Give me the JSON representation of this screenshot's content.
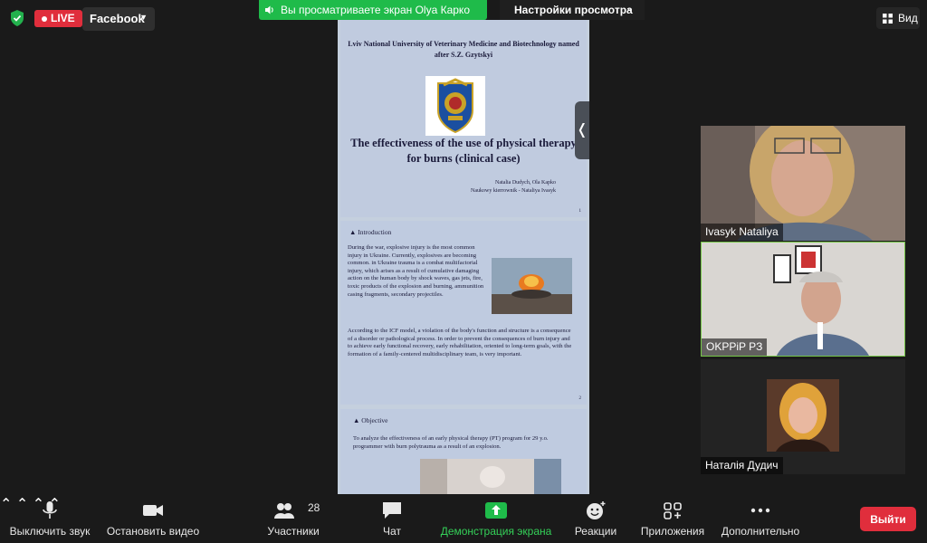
{
  "topbar": {
    "live_label": "LIVE",
    "stream_platform": "Facebook",
    "share_banner": "Вы просматриваете экран Olya Карко",
    "view_options": "Настройки просмотра",
    "view_button": "Вид"
  },
  "slides": {
    "s1": {
      "university": "Lviv National University of Veterinary Medicine and Biotechnology named after  S.Z.  Gzytskyi",
      "title": "The effectiveness of the use of physical therapy for burns (clinical case)",
      "authors_line1": "Natalia Dudych, Ola Kapko",
      "authors_line2": "Naukowy kierrownik - Nataliya Ivasyk",
      "page": "1"
    },
    "s2": {
      "heading": "▲ Introduction",
      "intro": " During the war, explosive injury is the most common injury in Ukraine. Currently, explosives are becoming common. in Ukraine trauma is a combat multifactorial injury, which arises as a result of cumulative damaging action on the human body by shock waves, gas jets, fire, toxic products of the explosion and burning, ammunition casing fragments, secondary projectiles.",
      "icf": "According to the ICF model, a violation of the body's function and structure is a consequence of a disorder or pathological process. In order to prevent the consequences of burn injury and to achieve early functional recovery, early rehabilitation, oriented to long-term goals, with the formation of a family-centered multidisciplinary team, is very important.",
      "page": "2"
    },
    "s3": {
      "heading": "▲ Objective",
      "text": "To analyze the effectiveness of an early physical therapy (PT) program for 29 y.o. programmer with burn polytrauma as a result of an explosion."
    }
  },
  "participants": [
    {
      "name": "Ivasyk Nataliya"
    },
    {
      "name": "OKPPiP PЗ"
    },
    {
      "name": "Наталія Дудич"
    }
  ],
  "toolbar": {
    "mute": "Выключить звук",
    "stop_video": "Остановить видео",
    "participants": "Участники",
    "participants_count": "28",
    "chat": "Чат",
    "share": "Демонстрация экрана",
    "reactions": "Реакции",
    "apps": "Приложения",
    "more": "Дополнительно",
    "leave": "Выйти"
  },
  "colors": {
    "live": "#e02e3c",
    "share_banner": "#1fbb4a",
    "active_speaker": "#76c648",
    "leave": "#e02e3c"
  }
}
